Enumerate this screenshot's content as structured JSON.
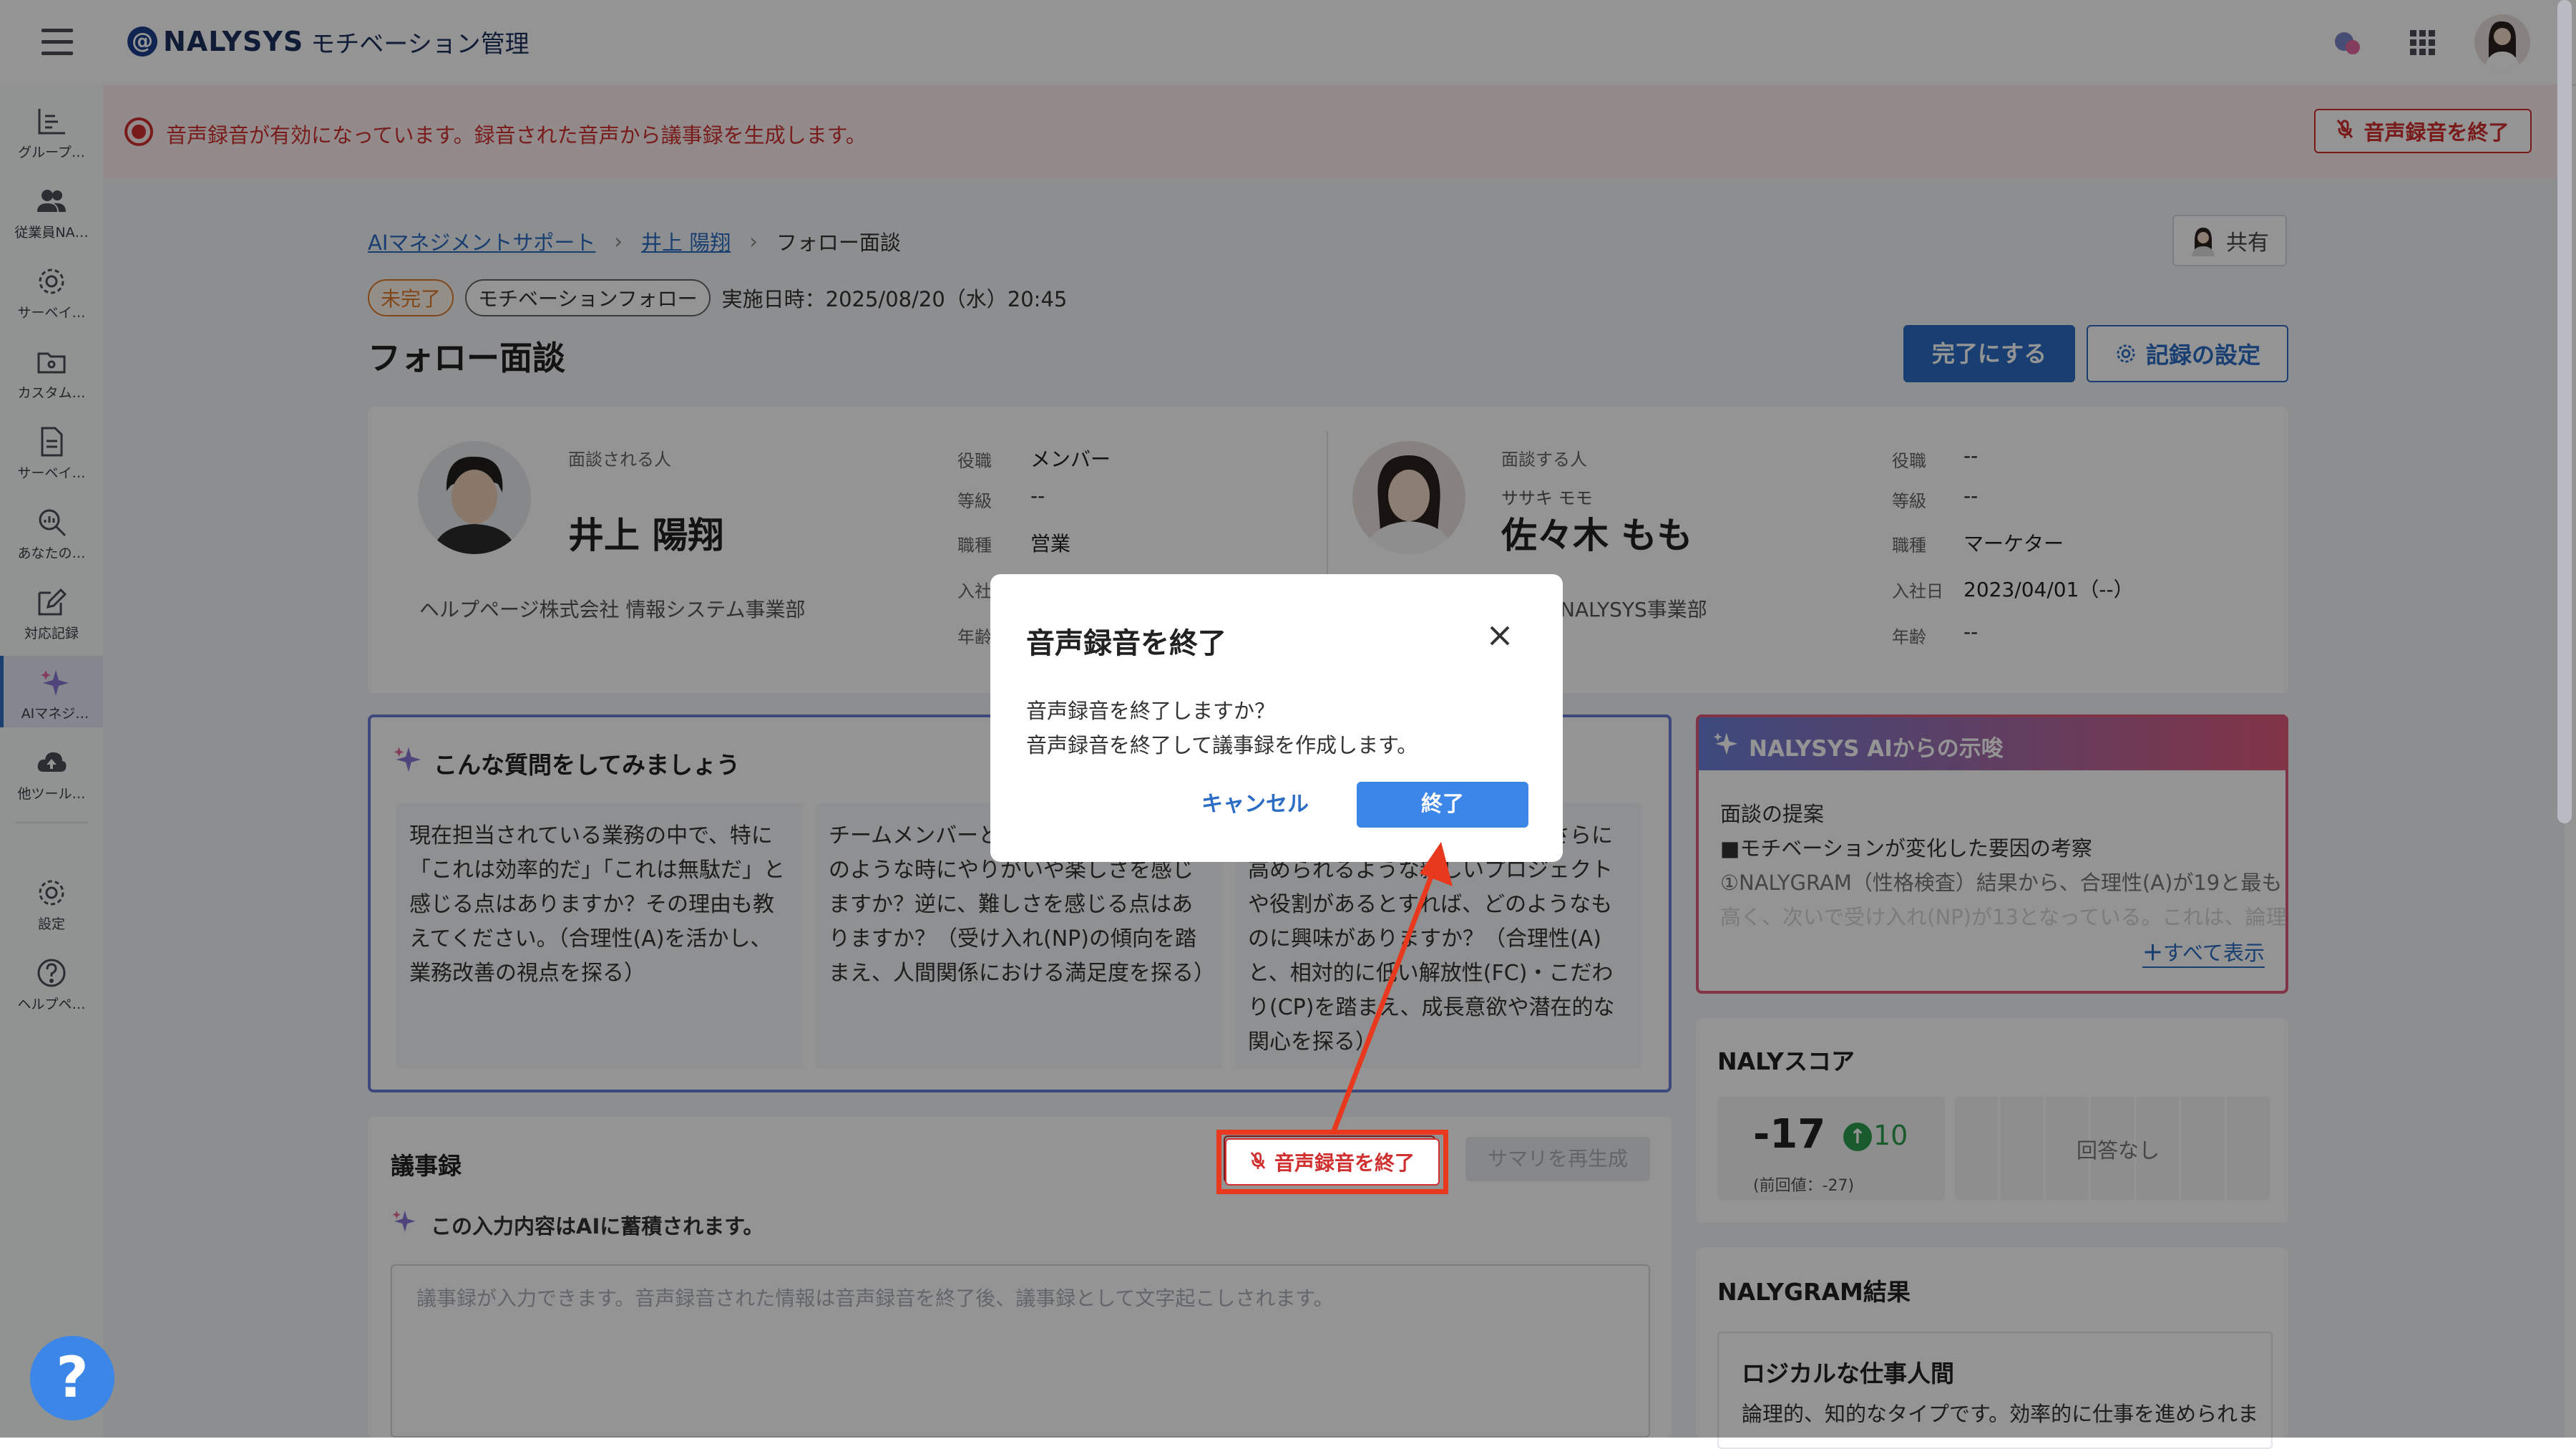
{
  "app": {
    "logo_text": "NALYSYS",
    "subtitle": "モチベーション管理"
  },
  "sidebar": {
    "items": [
      {
        "label": "グループ…",
        "icon": "bar-chart-icon"
      },
      {
        "label": "従業員NA…",
        "icon": "users-icon"
      },
      {
        "label": "サーベイ…",
        "icon": "gear-icon"
      },
      {
        "label": "カスタム…",
        "icon": "folder-icon"
      },
      {
        "label": "サーベイ…",
        "icon": "document-icon"
      },
      {
        "label": "あなたの…",
        "icon": "search-icon"
      },
      {
        "label": "対応記録",
        "icon": "edit-icon"
      },
      {
        "label": "AIマネジ…",
        "icon": "sparkle-icon"
      },
      {
        "label": "他ツール…",
        "icon": "cloud-upload-icon"
      },
      {
        "label": "設定",
        "icon": "gear-icon"
      },
      {
        "label": "ヘルプペ…",
        "icon": "help-icon"
      }
    ]
  },
  "banner": {
    "message": "音声録音が有効になっています。録音された音声から議事録を生成します。",
    "stop_button": "音声録音を終了"
  },
  "breadcrumb": {
    "items": [
      "AIマネジメントサポート",
      "井上 陽翔",
      "フォロー面談"
    ]
  },
  "share_button": "共有",
  "status": {
    "incomplete": "未完了",
    "category": "モチベーションフォロー",
    "date": "実施日時：2025/08/20（水）20:45"
  },
  "page_title": "フォロー面談",
  "actions": {
    "complete": "完了にする",
    "settings": "記録の設定"
  },
  "interviewee": {
    "caption": "面談される人",
    "name": "井上 陽翔",
    "org": "ヘルプページ株式会社 情報システム事業部",
    "fields": [
      {
        "label": "役職",
        "value": "メンバー"
      },
      {
        "label": "等級",
        "value": "--"
      },
      {
        "label": "職種",
        "value": "営業"
      },
      {
        "label": "入社",
        "value": ""
      },
      {
        "label": "年齢",
        "value": ""
      }
    ]
  },
  "interviewer": {
    "caption": "面談する人",
    "kana": "ササキ モモ",
    "name": "佐々木 もも",
    "org": "NALYSYS事業部",
    "fields": [
      {
        "label": "役職",
        "value": "--"
      },
      {
        "label": "等級",
        "value": "--"
      },
      {
        "label": "職種",
        "value": "マーケター"
      },
      {
        "label": "入社日",
        "value": "2023/04/01（--）"
      },
      {
        "label": "年齢",
        "value": "--"
      }
    ]
  },
  "questions": {
    "title": "こんな質問をしてみましょう",
    "cards": [
      "現在担当されている業務の中で、特に「これは効率的だ」「これは無駄だ」と感じる点はありますか？その理由も教えてください。（合理性(A)を活かし、業務改善の視点を探る）",
      "チームメンバーとの関わりの中で、どのような時にやりがいや楽しさを感じますか？逆に、難しさを感じる点はありますか？（受け入れ(NP)の傾向を踏まえ、人間関係における満足度を探る）",
      "今後、ご自身のスキルや知識をさらに高められるような新しいプロジェクトや役割があるとすれば、どのようなものに興味がありますか？（合理性(A)と、相対的に低い解放性(FC)・こだわり(CP)を踏まえ、成長意欲や潜在的な関心を探る）"
    ]
  },
  "ai_suggestion": {
    "title": "NALYSYS AIからの示唆",
    "line1": "面談の提案",
    "line2": "■モチベーションが変化した要因の考察",
    "line3": "①NALYGRAM（性格検査）結果から、合理性(A)が19と最も",
    "line4": "高く、次いで受け入れ(NP)が13となっている。これは、論理",
    "show_all": "すべて表示"
  },
  "minutes": {
    "title": "議事録",
    "stop_button": "音声録音を終了",
    "regen_button": "サマリを再生成",
    "ai_note": "この入力内容はAIに蓄積されます。",
    "placeholder": "議事録が入力できます。音声録音された情報は音声録音を終了後、議事録として文字起こしされます。"
  },
  "naly_score": {
    "title": "NALYスコア",
    "value": "-17",
    "delta": "10",
    "prev": "(前回値：-27)",
    "no_answer": "回答なし"
  },
  "nalygram": {
    "title": "NALYGRAM結果",
    "type": "ロジカルな仕事人間",
    "desc": "論理的、知的なタイプです。効率的に仕事を進められま"
  },
  "modal": {
    "title": "音声録音を終了",
    "line1": "音声録音を終了しますか？",
    "line2": "音声録音を終了して議事録を作成します。",
    "cancel": "キャンセル",
    "confirm": "終了"
  },
  "help_fab": "?",
  "colors": {
    "primary": "#2b6cc4",
    "danger": "#d0302f",
    "ai_gradient_start": "#6a7fd8",
    "ai_gradient_end": "#e05a7a",
    "overlay": "rgba(0,0,0,0.42)"
  }
}
